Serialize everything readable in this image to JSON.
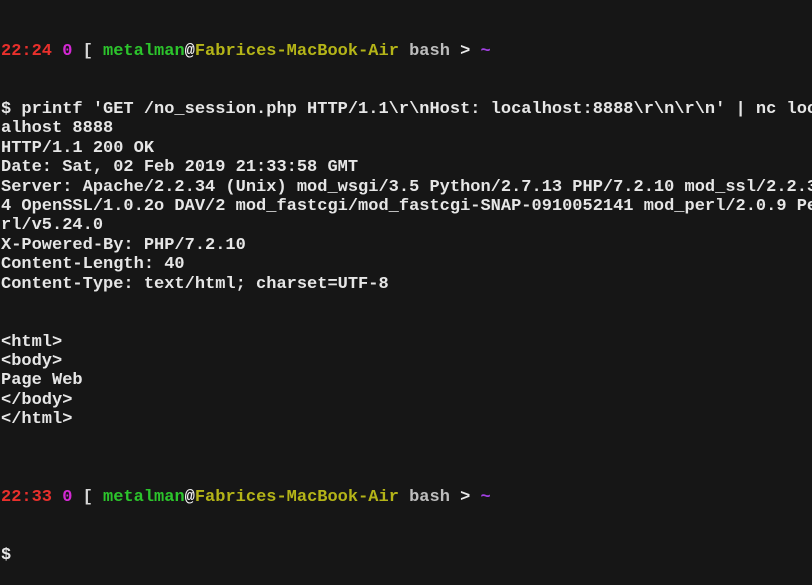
{
  "colors": {
    "background": "#161616",
    "text": "#e6e6e6",
    "time": "#e8302c",
    "status": "#d428d4",
    "user": "#2cc42c",
    "host": "#b4b418",
    "cwd": "#a040e0"
  },
  "prompts": [
    {
      "time": "22:24",
      "status": "0",
      "bracket": "[",
      "user": "metalman",
      "at": "@",
      "host": "Fabrices-MacBook-Air",
      "shell": "bash",
      "arrow": ">",
      "cwd": "~"
    },
    {
      "time": "22:33",
      "status": "0",
      "bracket": "[",
      "user": "metalman",
      "at": "@",
      "host": "Fabrices-MacBook-Air",
      "shell": "bash",
      "arrow": ">",
      "cwd": "~"
    }
  ],
  "output": [
    "$ printf 'GET /no_session.php HTTP/1.1\\r\\nHost: localhost:8888\\r\\n\\r\\n' | nc loc",
    "alhost 8888",
    "HTTP/1.1 200 OK",
    "Date: Sat, 02 Feb 2019 21:33:58 GMT",
    "Server: Apache/2.2.34 (Unix) mod_wsgi/3.5 Python/2.7.13 PHP/7.2.10 mod_ssl/2.2.3",
    "4 OpenSSL/1.0.2o DAV/2 mod_fastcgi/mod_fastcgi-SNAP-0910052141 mod_perl/2.0.9 Pe",
    "rl/v5.24.0",
    "X-Powered-By: PHP/7.2.10",
    "Content-Length: 40",
    "Content-Type: text/html; charset=UTF-8",
    "",
    "",
    "<html>",
    "<body>",
    "Page Web",
    "</body>",
    "</html>",
    ""
  ],
  "final_prompt": "$"
}
